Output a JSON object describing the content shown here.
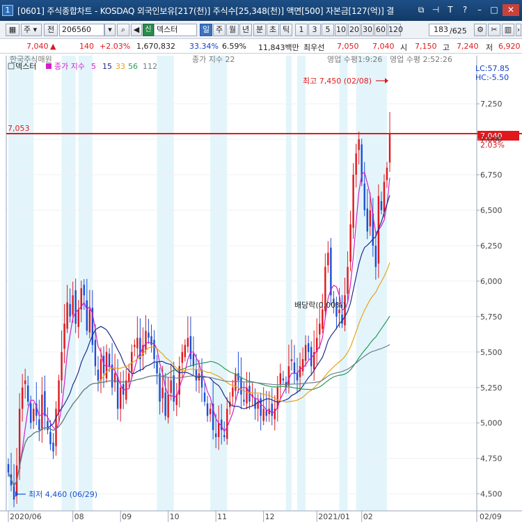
{
  "window": {
    "number": "1",
    "title": "[0601] 주식종합차트 - KOSDAQ 외국인보유[217(천)] 주식수[25,348(천)] 액면[500] 자본금[127(억)] 결",
    "icons": [
      "restore-icon",
      "pin-icon",
      "text-icon",
      "help-icon",
      "minimize-icon",
      "maximize-icon",
      "close-icon"
    ]
  },
  "toolbar": {
    "period_type": "주",
    "whole_label": "전",
    "stock_code": "206560",
    "new_badge": "신",
    "stock_name": "덱스터",
    "periods": [
      "일",
      "주",
      "월",
      "년",
      "분",
      "초",
      "틱"
    ],
    "active_period": "일",
    "intervals": [
      "1",
      "3",
      "5",
      "10",
      "20",
      "30",
      "60",
      "120"
    ],
    "count_value": "183",
    "count_total": "/625"
  },
  "quote": {
    "price": "7,040",
    "arrow": "▲",
    "change": "140",
    "change_pct": "+2.03%",
    "volume": "1,670,832",
    "vol_ratio": "33.34%",
    "turnover": "6.59%",
    "amount": "11,843백만",
    "priority_label": "최우선",
    "ask": "7,050",
    "bid": "7,040",
    "open_label": "시",
    "open": "7,150",
    "high_label": "고",
    "high": "7,240",
    "low_label": "저",
    "low": "6,920"
  },
  "chart": {
    "overlap_text_1": "한국주식매원",
    "overlap_text_2": "종가 지수 22",
    "overlap_text_3": "영업 수평1:9:26",
    "overlap_text_4": "영업 수평 2:52:26",
    "legend_name": "덱스터",
    "legend_ma_label": "종가 지수",
    "legend_ma": [
      {
        "period": "5",
        "color": "#d21ec8"
      },
      {
        "period": "15",
        "color": "#1e2a8c"
      },
      {
        "period": "33",
        "color": "#e8a21a"
      },
      {
        "period": "56",
        "color": "#2a9a55"
      },
      {
        "period": "112",
        "color": "#6b7f8c"
      }
    ],
    "lc_label": "LC:57.85",
    "hc_label": "HC:-5.50",
    "high_note": "최고 7,450 (02/08)",
    "low_note": "최저 4,460 (06/29)",
    "dividend_note": "배당락(0.00%)",
    "ref_line_label": "7,053",
    "price_tag": "7,040",
    "pct_tag": "2.03%",
    "y_ticks": [
      "7,250",
      "7,000",
      "6,750",
      "6,500",
      "6,250",
      "6,000",
      "5,750",
      "5,500",
      "5,250",
      "5,000",
      "4,750",
      "4,500"
    ],
    "x_ticks": [
      "2020/06",
      "08",
      "09",
      "10",
      "11",
      "12",
      "2021/01",
      "02"
    ],
    "x_right_label": "02/09",
    "up_color": "#e0181d",
    "down_color": "#1a4fd6",
    "shade_color": "#e3f5fb"
  },
  "chart_data": {
    "type": "candlestick",
    "title": "덱스터",
    "ylim": [
      4400,
      7550
    ],
    "ref_line": 7053,
    "last_close": 7040,
    "high": {
      "value": 7450,
      "date": "02/08"
    },
    "low": {
      "value": 4460,
      "date": "06/29"
    },
    "close_series": [
      4650,
      4560,
      4460,
      4700,
      5100,
      5250,
      5300,
      5150,
      5000,
      5100,
      5050,
      4950,
      5200,
      5050,
      4950,
      4850,
      4800,
      5100,
      5300,
      5500,
      5700,
      5850,
      5750,
      5900,
      5700,
      5800,
      5950,
      5900,
      5650,
      5800,
      5550,
      5400,
      5300,
      5450,
      5350,
      5500,
      5400,
      5250,
      5350,
      5100,
      5250,
      5200,
      5300,
      5350,
      5500,
      5550,
      5600,
      5450,
      5550,
      5650,
      5600,
      5550,
      5450,
      5350,
      5150,
      5250,
      5050,
      5200,
      5300,
      5150,
      5200,
      5400,
      5500,
      5550,
      5600,
      5450,
      5400,
      5300,
      5350,
      5250,
      5150,
      5050,
      5100,
      4950,
      4900,
      5000,
      4950,
      4900,
      5100,
      5150,
      5250,
      5350,
      5300,
      5200,
      5150,
      5250,
      5150,
      5200,
      5100,
      5150,
      5050,
      5100,
      5050,
      5100,
      5050,
      5100,
      5250,
      5350,
      5300,
      5250,
      5400,
      5450,
      5350,
      5300,
      5400,
      5450,
      5550,
      5500,
      5400,
      5500,
      5600,
      5700,
      5800,
      6100,
      6200,
      5900,
      5850,
      5750,
      5800,
      5700,
      5900,
      6100,
      6400,
      6750,
      6900,
      7000,
      6700,
      6500,
      6350,
      6500,
      6250,
      6100,
      6600,
      6500,
      6700,
      6800,
      7040
    ],
    "ma_periods": [
      5,
      15,
      33,
      56,
      112
    ]
  }
}
